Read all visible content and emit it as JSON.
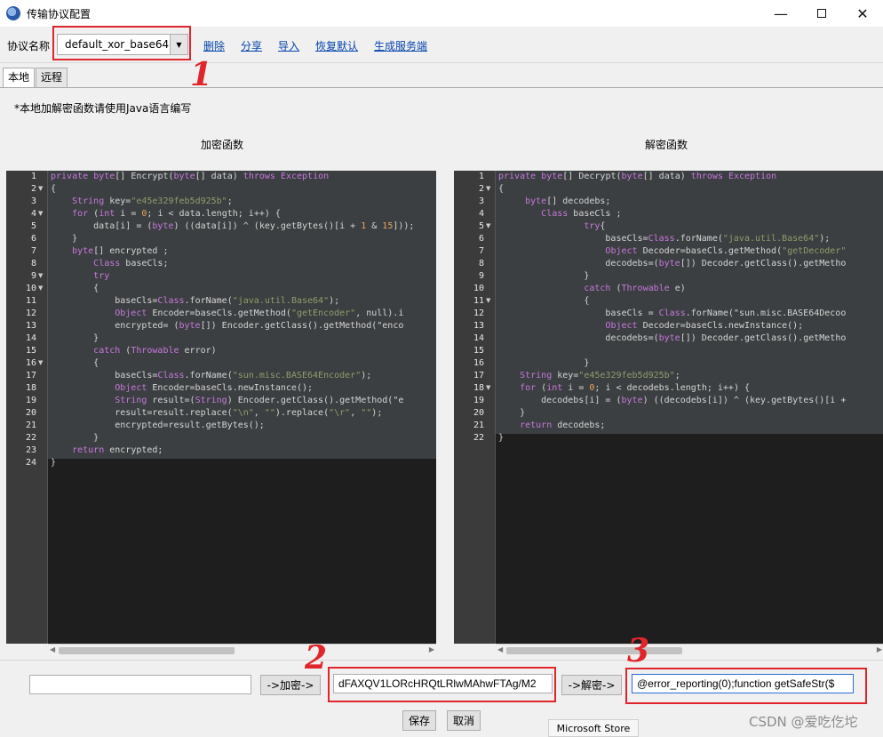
{
  "window": {
    "title": "传输协议配置",
    "minimize": "—",
    "maximize": "",
    "close": "✕"
  },
  "toolbar": {
    "label": "协议名称",
    "protocol_value": "default_xor_base64",
    "links": [
      "删除",
      "分享",
      "导入",
      "恢复默认",
      "生成服务端"
    ]
  },
  "tabs": [
    {
      "label": "本地",
      "active": true
    },
    {
      "label": "远程",
      "active": false
    }
  ],
  "note": "*本地加解密函数请使用Java语言编写",
  "encrypt": {
    "heading": "加密函数",
    "lines": [
      "private byte[] Encrypt(byte[] data) throws Exception",
      "{",
      "    String key=\"e45e329feb5d925b\";",
      "    for (int i = 0; i < data.length; i++) {",
      "        data[i] = (byte) ((data[i]) ^ (key.getBytes()[i + 1 & 15]));",
      "    }",
      "    byte[] encrypted ;",
      "        Class baseCls;",
      "        try",
      "        {",
      "            baseCls=Class.forName(\"java.util.Base64\");",
      "            Object Encoder=baseCls.getMethod(\"getEncoder\", null).i",
      "            encrypted= (byte[]) Encoder.getClass().getMethod(\"enco",
      "        }",
      "        catch (Throwable error)",
      "        {",
      "            baseCls=Class.forName(\"sun.misc.BASE64Encoder\");",
      "            Object Encoder=baseCls.newInstance();",
      "            String result=(String) Encoder.getClass().getMethod(\"e",
      "            result=result.replace(\"\\n\", \"\").replace(\"\\r\", \"\");",
      "            encrypted=result.getBytes();",
      "        }",
      "    return encrypted;",
      "}"
    ]
  },
  "decrypt": {
    "heading": "解密函数",
    "lines": [
      "private byte[] Decrypt(byte[] data) throws Exception",
      "{",
      "     byte[] decodebs;",
      "        Class baseCls ;",
      "                try{",
      "                    baseCls=Class.forName(\"java.util.Base64\");",
      "                    Object Decoder=baseCls.getMethod(\"getDecoder\"",
      "                    decodebs=(byte[]) Decoder.getClass().getMetho",
      "                }",
      "                catch (Throwable e)",
      "                {",
      "                    baseCls = Class.forName(\"sun.misc.BASE64Decoo",
      "                    Object Decoder=baseCls.newInstance();",
      "                    decodebs=(byte[]) Decoder.getClass().getMetho",
      "",
      "                }",
      "    String key=\"e45e329feb5d925b\";",
      "    for (int i = 0; i < decodebs.length; i++) {",
      "        decodebs[i] = (byte) ((decodebs[i]) ^ (key.getBytes()[i +",
      "    }",
      "    return decodebs;",
      "}"
    ]
  },
  "bottom": {
    "plain_input": "",
    "encrypt_button": "->加密->",
    "encrypted_output": "dFAXQV1LORcHRQtLRlwMAhwFTAg/M2",
    "decrypt_button": "->解密->",
    "decrypted_output": "@error_reporting(0);function getSafeStr($",
    "save_button": "保存",
    "cancel_button": "取消"
  },
  "annotations": {
    "num1": "1",
    "num2": "2",
    "num3": "3",
    "color": "#e0262b"
  },
  "tooltip": "Microsoft Store",
  "watermark": "CSDN @爱吃仡坨"
}
